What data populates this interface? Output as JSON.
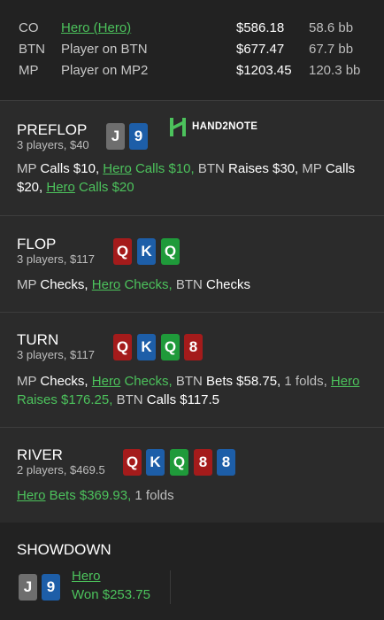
{
  "players": [
    {
      "pos": "CO",
      "name": "Hero (Hero)",
      "is_hero": true,
      "stack": "$586.18",
      "bb": "58.6 bb"
    },
    {
      "pos": "BTN",
      "name": "Player on BTN",
      "is_hero": false,
      "stack": "$677.47",
      "bb": "67.7 bb"
    },
    {
      "pos": "MP",
      "name": "Player on MP2",
      "is_hero": false,
      "stack": "$1203.45",
      "bb": "120.3 bb"
    }
  ],
  "logo": {
    "text": "HAND2NOTE",
    "icon": "h2n-logo-icon",
    "color": "#4cc25c"
  },
  "streets": {
    "preflop": {
      "title": "PREFLOP",
      "sub": "3 players, $40",
      "cards": [
        "J",
        "9"
      ]
    },
    "flop": {
      "title": "FLOP",
      "sub": "3 players, $117",
      "cards": [
        "Q",
        "K",
        "Q"
      ]
    },
    "turn": {
      "title": "TURN",
      "sub": "3 players, $117",
      "cards": [
        "Q",
        "K",
        "Q",
        "8"
      ]
    },
    "river": {
      "title": "RIVER",
      "sub": "2 players, $469.5",
      "cards": [
        "Q",
        "K",
        "Q",
        "8",
        "8"
      ]
    }
  },
  "actions": {
    "preflop": {
      "mp": "MP ",
      "a1": "Calls $10, ",
      "hero1": "Hero",
      "h1": " Calls $10, ",
      "btn": "BTN ",
      "a2": "Raises $30, ",
      "mp2": "MP ",
      "a3": "Calls $20, ",
      "hero2": "Hero",
      "h2": " Calls $20"
    },
    "flop": {
      "mp": "MP ",
      "a1": "Checks, ",
      "hero": "Hero",
      "h1": " Checks, ",
      "btn": "BTN ",
      "a2": "Checks"
    },
    "turn": {
      "mp": "MP ",
      "a1": "Checks, ",
      "hero1": "Hero",
      "h1": " Checks, ",
      "btn": "BTN ",
      "a2": "Bets $58.75, ",
      "f": "1 folds, ",
      "hero2": "Hero",
      "h2": " Raises $176.25, ",
      "btn2": "BTN ",
      "a3": "Calls $117.5"
    },
    "river": {
      "hero": "Hero",
      "h1": " Bets $369.93, ",
      "f": "1 folds"
    }
  },
  "showdown": {
    "title": "SHOWDOWN",
    "cards": [
      "J",
      "9"
    ],
    "winner": "Hero",
    "won": "Won $253.75"
  },
  "colors": {
    "hero": "#4cc25c",
    "spade": "#6e6e6e",
    "club": "#1d5ea8",
    "heart": "#a41b1b",
    "diamond": "#1f9a3a"
  }
}
